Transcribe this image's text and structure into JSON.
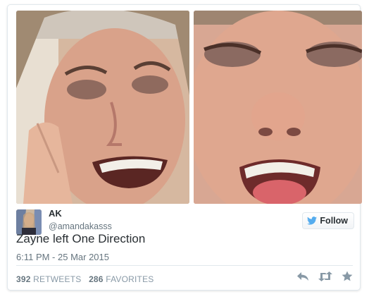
{
  "tweet": {
    "author_name": "AK",
    "handle": "@amandakasss",
    "follow_label": "Follow",
    "text": "Zayne left One Direction",
    "timestamp": "6:11 PM - 25 Mar 2015",
    "retweets_count": "392",
    "retweets_label": "RETWEETS",
    "favorites_count": "286",
    "favorites_label": "FAVORITES"
  },
  "icons": {
    "follow": "bird-icon",
    "reply": "reply-icon",
    "retweet": "retweet-icon",
    "favorite": "star-icon"
  },
  "colors": {
    "accent": "#55acee",
    "text": "#292f33",
    "muted": "#66757f",
    "border": "#e1e8ed",
    "icon": "#8899a6"
  }
}
